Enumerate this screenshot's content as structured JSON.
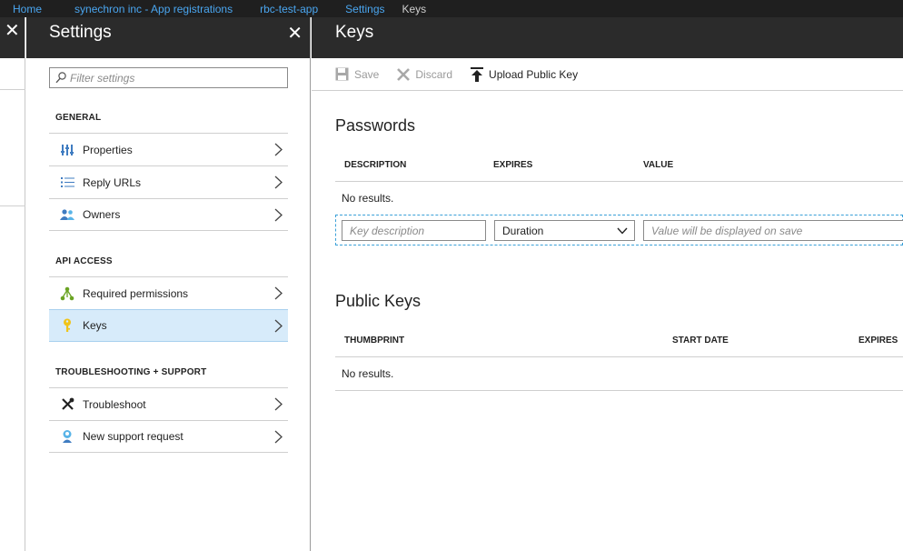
{
  "breadcrumb": {
    "items": [
      "Home",
      "synechron inc - App registrations",
      "rbc-test-app",
      "Settings"
    ],
    "current": "Keys"
  },
  "settings": {
    "title": "Settings",
    "filter_placeholder": "Filter settings",
    "sections": [
      {
        "label": "GENERAL",
        "items": [
          {
            "label": "Properties",
            "icon": "properties-icon"
          },
          {
            "label": "Reply URLs",
            "icon": "list-icon"
          },
          {
            "label": "Owners",
            "icon": "owners-icon"
          }
        ]
      },
      {
        "label": "API ACCESS",
        "items": [
          {
            "label": "Required permissions",
            "icon": "permissions-icon"
          },
          {
            "label": "Keys",
            "icon": "key-icon",
            "active": true
          }
        ]
      },
      {
        "label": "TROUBLESHOOTING + SUPPORT",
        "items": [
          {
            "label": "Troubleshoot",
            "icon": "tools-icon"
          },
          {
            "label": "New support request",
            "icon": "support-icon"
          }
        ]
      }
    ]
  },
  "keys": {
    "title": "Keys",
    "toolbar": {
      "save": "Save",
      "discard": "Discard",
      "upload": "Upload Public Key"
    },
    "passwords": {
      "title": "Passwords",
      "columns": [
        "DESCRIPTION",
        "EXPIRES",
        "VALUE"
      ],
      "empty": "No results.",
      "key_description_placeholder": "Key description",
      "duration_value": "Duration",
      "value_placeholder": "Value will be displayed on save"
    },
    "public_keys": {
      "title": "Public Keys",
      "columns": [
        "THUMBPRINT",
        "START DATE",
        "EXPIRES"
      ],
      "empty": "No results."
    }
  },
  "colors": {
    "header_bg": "#2b2b2b",
    "link": "#4aa6f0",
    "active_item": "#d7ebfa",
    "dashed_border": "#3aa0d8"
  }
}
